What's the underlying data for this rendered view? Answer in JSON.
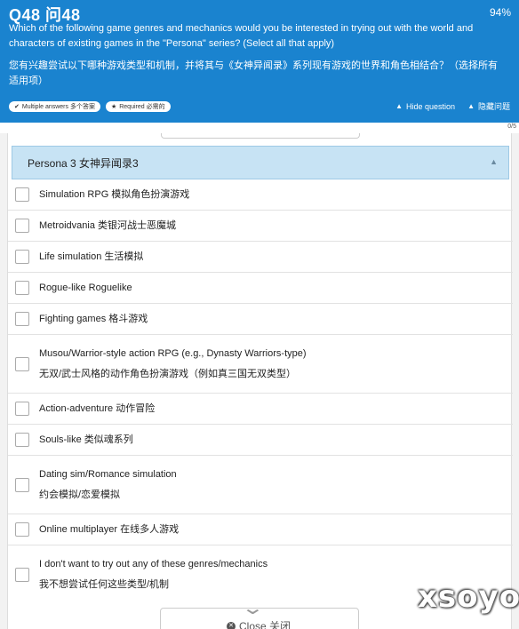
{
  "header": {
    "question_number": "Q48 问48",
    "percent": "94%",
    "question_en": "Which of the following game genres and mechanics would you be interested in trying out with the world and characters of existing games in the \"Persona\" series? (Select all that apply)",
    "question_cn": "您有兴趣尝试以下哪种游戏类型和机制，并将其与《女神异闻录》系列现有游戏的世界和角色相结合？（选择所有适用项）",
    "badges": [
      {
        "label": "Multiple answers 多个答案",
        "icon": "check-icon"
      },
      {
        "label": "Required 必需的",
        "icon": "star-icon"
      }
    ],
    "hide_question": "Hide question",
    "hide_question_cn": "隐藏问题"
  },
  "progress": {
    "count": "0/5"
  },
  "group": {
    "title": "Persona 3 女神异闻录3"
  },
  "options": [
    {
      "line1": "Simulation RPG 模拟角色扮演游戏"
    },
    {
      "line1": "Metroidvania 类银河战士恶魔城"
    },
    {
      "line1": "Life simulation 生活模拟"
    },
    {
      "line1": "Rogue-like Roguelike"
    },
    {
      "line1": "Fighting games 格斗游戏"
    },
    {
      "line1": "Musou/Warrior-style action RPG (e.g., Dynasty Warriors-type)",
      "line2": "无双/武士风格的动作角色扮演游戏（例如真三国无双类型）"
    },
    {
      "line1": "Action-adventure 动作冒险"
    },
    {
      "line1": "Souls-like 类似魂系列"
    },
    {
      "line1": "Dating sim/Romance simulation",
      "line2": "约会模拟/恋爱模拟"
    },
    {
      "line1": "Online multiplayer 在线多人游戏"
    },
    {
      "line1": "I don't want to try out any of these genres/mechanics",
      "line2": "我不想尝试任何这些类型/机制"
    }
  ],
  "close": {
    "label": "Close 关闭"
  },
  "watermark": "xsoyo",
  "colors": {
    "header_bg": "#1a83cf",
    "group_header_bg": "#c7e3f4"
  }
}
